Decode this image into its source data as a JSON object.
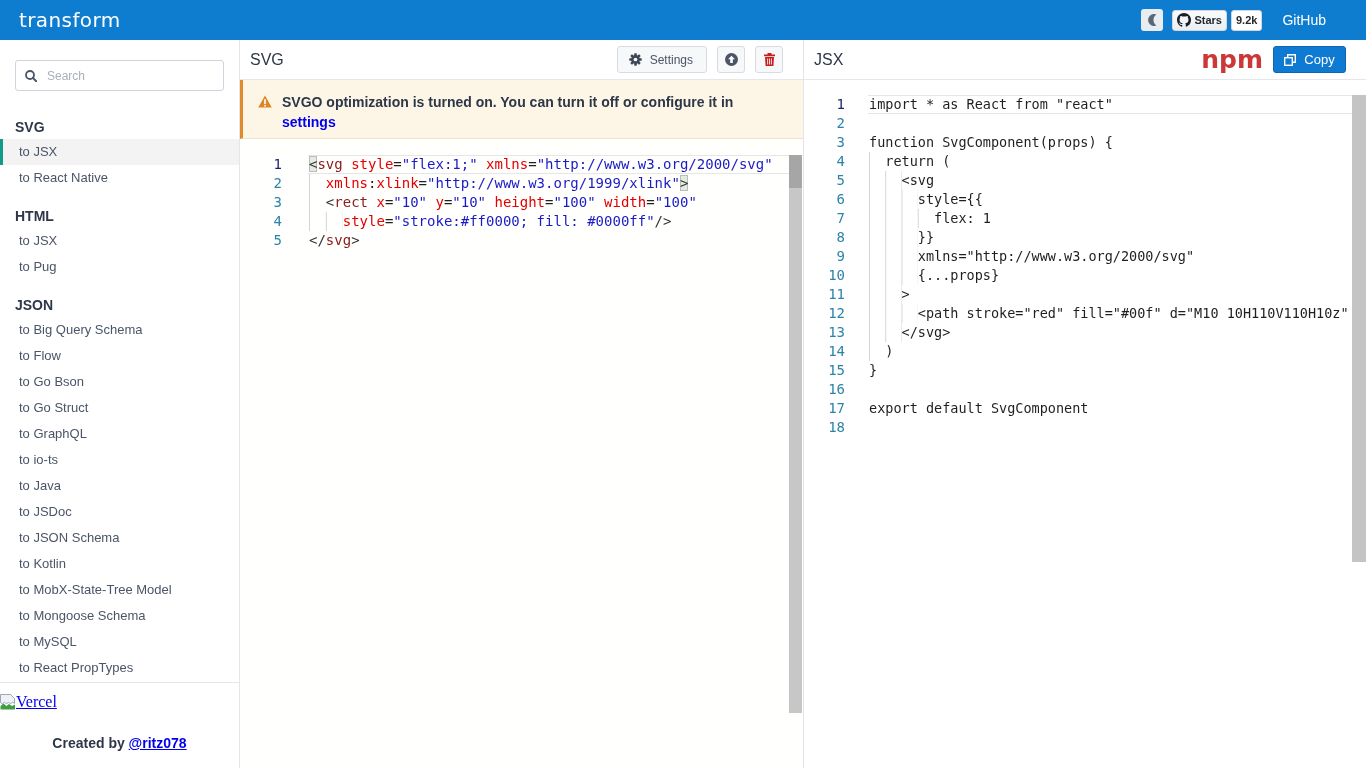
{
  "header": {
    "logo": "transform",
    "stars_button": {
      "label": "Stars",
      "count": "9.2k"
    },
    "github_link": "GitHub"
  },
  "sidebar": {
    "search": {
      "placeholder": "Search"
    },
    "sections": [
      {
        "title": "SVG",
        "items": [
          {
            "label": "to JSX",
            "selected": true
          },
          {
            "label": "to React Native",
            "selected": false
          }
        ]
      },
      {
        "title": "HTML",
        "items": [
          {
            "label": "to JSX",
            "selected": false
          },
          {
            "label": "to Pug",
            "selected": false
          }
        ]
      },
      {
        "title": "JSON",
        "items": [
          {
            "label": "to Big Query Schema",
            "selected": false
          },
          {
            "label": "to Flow",
            "selected": false
          },
          {
            "label": "to Go Bson",
            "selected": false
          },
          {
            "label": "to Go Struct",
            "selected": false
          },
          {
            "label": "to GraphQL",
            "selected": false
          },
          {
            "label": "to io-ts",
            "selected": false
          },
          {
            "label": "to Java",
            "selected": false
          },
          {
            "label": "to JSDoc",
            "selected": false
          },
          {
            "label": "to JSON Schema",
            "selected": false
          },
          {
            "label": "to Kotlin",
            "selected": false
          },
          {
            "label": "to MobX-State-Tree Model",
            "selected": false
          },
          {
            "label": "to Mongoose Schema",
            "selected": false
          },
          {
            "label": "to MySQL",
            "selected": false
          },
          {
            "label": "to React PropTypes",
            "selected": false
          }
        ]
      }
    ],
    "vercel_link": "Vercel",
    "credit": {
      "text": "Created by",
      "link": "@ritz078"
    }
  },
  "input_panel": {
    "title": "SVG",
    "buttons": [
      {
        "kind": "settings",
        "label": "Settings"
      },
      {
        "kind": "upload"
      },
      {
        "kind": "delete"
      }
    ],
    "notice": {
      "text": "SVGO optimization is turned on. You can turn it off or configure it in",
      "link": "settings"
    },
    "editor": {
      "lines": [
        {
          "number": "1",
          "active": true,
          "tokens": [
            {
              "kind": "match",
              "text": "<"
            },
            {
              "kind": "tag",
              "text": "svg"
            },
            {
              "kind": "attr",
              "text": " style"
            },
            {
              "kind": "plain",
              "text": "="
            },
            {
              "kind": "string",
              "text": "\"flex:1;\""
            },
            {
              "kind": "attr",
              "text": " xmlns"
            },
            {
              "kind": "plain",
              "text": "="
            },
            {
              "kind": "string",
              "text": "\"http://www.w3.org/2000/svg\""
            }
          ]
        },
        {
          "number": "2",
          "active": false,
          "tokens": [
            {
              "kind": "attr",
              "text": "  xmlns"
            },
            {
              "kind": "plain",
              "text": ":"
            },
            {
              "kind": "attr",
              "text": "xlink"
            },
            {
              "kind": "plain",
              "text": "="
            },
            {
              "kind": "string",
              "text": "\"http://www.w3.org/1999/xlink\""
            },
            {
              "kind": "match",
              "text": ">"
            }
          ]
        },
        {
          "number": "3",
          "active": false,
          "tokens": [
            {
              "kind": "bracket",
              "text": "  <"
            },
            {
              "kind": "tag",
              "text": "rect"
            },
            {
              "kind": "attr",
              "text": " x"
            },
            {
              "kind": "plain",
              "text": "="
            },
            {
              "kind": "string",
              "text": "\"10\""
            },
            {
              "kind": "attr",
              "text": " y"
            },
            {
              "kind": "plain",
              "text": "="
            },
            {
              "kind": "string",
              "text": "\"10\""
            },
            {
              "kind": "attr",
              "text": " height"
            },
            {
              "kind": "plain",
              "text": "="
            },
            {
              "kind": "string",
              "text": "\"100\""
            },
            {
              "kind": "attr",
              "text": " width"
            },
            {
              "kind": "plain",
              "text": "="
            },
            {
              "kind": "string",
              "text": "\"100\""
            }
          ]
        },
        {
          "number": "4",
          "active": false,
          "tokens": [
            {
              "kind": "attr",
              "text": "    style"
            },
            {
              "kind": "plain",
              "text": "="
            },
            {
              "kind": "string",
              "text": "\"stroke:#ff0000; fill: #0000ff\""
            },
            {
              "kind": "bracket",
              "text": "/>"
            }
          ]
        },
        {
          "number": "5",
          "active": false,
          "tokens": [
            {
              "kind": "bracket",
              "text": "</"
            },
            {
              "kind": "tag",
              "text": "svg"
            },
            {
              "kind": "bracket",
              "text": ">"
            }
          ]
        }
      ]
    }
  },
  "output_panel": {
    "title": "JSX",
    "npm_logo": "npm",
    "copy_button": "Copy",
    "editor": {
      "lines": [
        {
          "number": "1",
          "active": true,
          "code": "import * as React from \"react\""
        },
        {
          "number": "2",
          "active": false
        },
        {
          "number": "3",
          "active": false,
          "code": "function SvgComponent(props) {"
        },
        {
          "number": "4",
          "active": false,
          "code": "  return ("
        },
        {
          "number": "5",
          "active": false,
          "code": "    <svg"
        },
        {
          "number": "6",
          "active": false,
          "code": "      style={{"
        },
        {
          "number": "7",
          "active": false,
          "code": "        flex: 1"
        },
        {
          "number": "8",
          "active": false,
          "code": "      }}"
        },
        {
          "number": "9",
          "active": false,
          "code": "      xmlns=\"http://www.w3.org/2000/svg\""
        },
        {
          "number": "10",
          "active": false,
          "code": "      {...props}"
        },
        {
          "number": "11",
          "active": false,
          "code": "    >"
        },
        {
          "number": "12",
          "active": false,
          "code": "      <path stroke=\"red\" fill=\"#00f\" d=\"M10 10H110V110H10z\""
        },
        {
          "number": "13",
          "active": false,
          "code": "    </svg>"
        },
        {
          "number": "14",
          "active": false,
          "code": "  )"
        },
        {
          "number": "15",
          "active": false,
          "code": "}"
        },
        {
          "number": "16",
          "active": false
        },
        {
          "number": "17",
          "active": false,
          "code": "export default SvgComponent"
        },
        {
          "number": "18",
          "active": false
        }
      ]
    }
  }
}
